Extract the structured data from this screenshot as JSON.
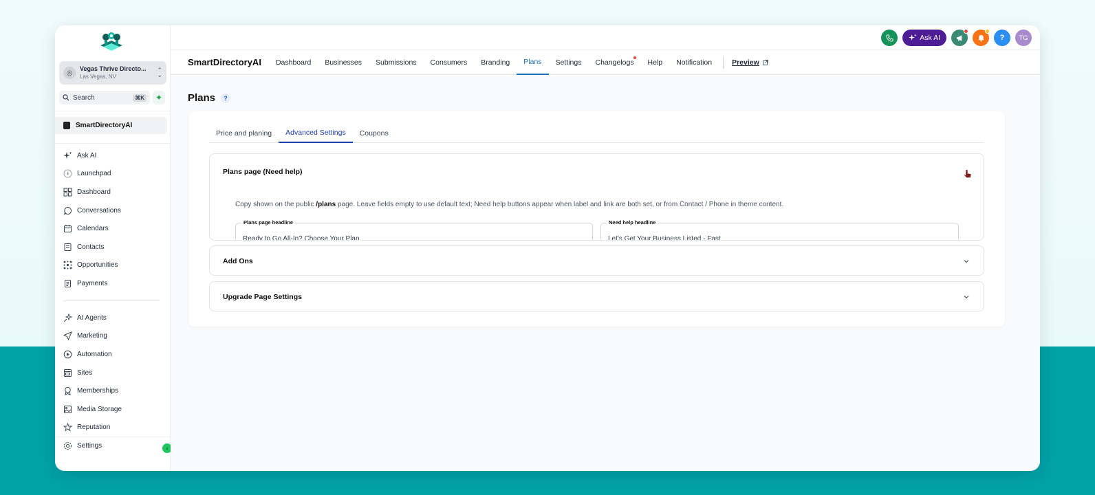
{
  "sidebar": {
    "location_name": "Vegas Thrive Directo...",
    "location_sub": "Las Vegas, NV",
    "search_label": "Search",
    "search_shortcut": "⌘K",
    "active_item": "SmartDirectoryAI",
    "group1": [
      {
        "label": "Ask AI",
        "icon": "sparkles-icon"
      },
      {
        "label": "Launchpad",
        "icon": "rocket-icon"
      },
      {
        "label": "Dashboard",
        "icon": "grid-icon"
      },
      {
        "label": "Conversations",
        "icon": "chat-bubble-icon"
      },
      {
        "label": "Calendars",
        "icon": "calendar-icon"
      },
      {
        "label": "Contacts",
        "icon": "contact-card-icon"
      },
      {
        "label": "Opportunities",
        "icon": "opportunities-icon"
      },
      {
        "label": "Payments",
        "icon": "receipt-icon"
      }
    ],
    "group2": [
      {
        "label": "AI Agents",
        "icon": "ai-agents-icon"
      },
      {
        "label": "Marketing",
        "icon": "send-icon"
      },
      {
        "label": "Automation",
        "icon": "automation-icon"
      },
      {
        "label": "Sites",
        "icon": "sites-icon"
      },
      {
        "label": "Memberships",
        "icon": "award-icon"
      },
      {
        "label": "Media Storage",
        "icon": "image-icon"
      },
      {
        "label": "Reputation",
        "icon": "star-icon"
      }
    ],
    "settings_label": "Settings"
  },
  "topbar": {
    "ask_ai_label": "Ask AI",
    "avatar_initials": "TG",
    "help_label": "?"
  },
  "nav": {
    "brand": "SmartDirectoryAI",
    "tabs": [
      {
        "label": "Dashboard"
      },
      {
        "label": "Businesses"
      },
      {
        "label": "Submissions"
      },
      {
        "label": "Consumers"
      },
      {
        "label": "Branding"
      },
      {
        "label": "Plans"
      },
      {
        "label": "Settings"
      },
      {
        "label": "Changelogs"
      },
      {
        "label": "Help"
      },
      {
        "label": "Notification"
      }
    ],
    "active_tab": "Plans",
    "preview_label": "Preview"
  },
  "page": {
    "title": "Plans",
    "help_mark": "?",
    "subtabs": [
      "Price and planing",
      "Advanced Settings",
      "Coupons"
    ],
    "active_subtab": "Advanced Settings",
    "accordions": [
      {
        "title": "Plans page (Need help)",
        "expanded": true,
        "description_pre": "Copy shown on the public ",
        "description_bold": "/plans",
        "description_post": " page. Leave fields empty to use default text; Need help buttons appear when label and link are both set, or from Contact / Phone in theme content.",
        "fields": [
          {
            "label": "Plans page headline",
            "value": "Ready to Go All-In? Choose Your Plan"
          },
          {
            "label": "Need help headline",
            "value": "Let's Get Your Business Listed - Fast"
          }
        ]
      },
      {
        "title": "Add Ons",
        "expanded": false
      },
      {
        "title": "Upgrade Page Settings",
        "expanded": false
      }
    ]
  },
  "colors": {
    "accent_blue": "#1d6fb8",
    "teal_background": "#00a2a8",
    "ask_ai_purple": "#4c1d95",
    "phone_green": "#15935a",
    "bell_orange": "#f97316",
    "help_blue": "#2b8ef0",
    "avatar_purple": "#a78bcd"
  }
}
